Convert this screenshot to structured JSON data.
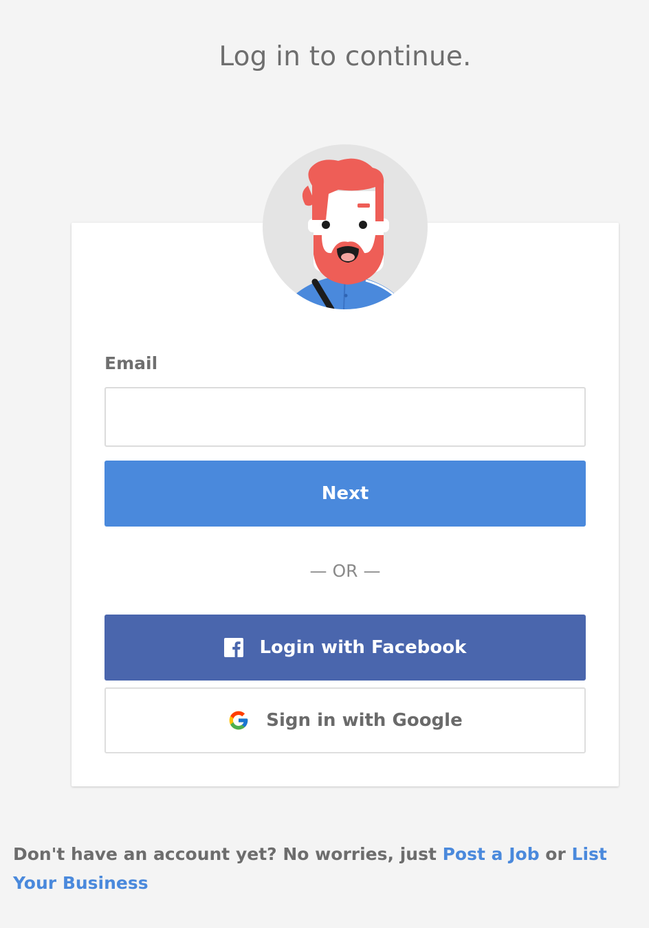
{
  "page": {
    "title": "Log in to continue."
  },
  "form": {
    "email_label": "Email",
    "email_value": "",
    "email_placeholder": "",
    "next_label": "Next",
    "divider_text": "— OR —",
    "facebook_label": "Login with Facebook",
    "google_label": "Sign in with Google"
  },
  "footer": {
    "prefix": "Don't have an account yet? No worries, just ",
    "post_job_link": "Post a Job",
    "joiner": " or ",
    "list_business_link": "List Your Business"
  },
  "colors": {
    "primary_blue": "#4a89dc",
    "facebook_blue": "#4a66ad",
    "background": "#f4f4f4",
    "avatar_hair": "#ee5e57"
  },
  "icons": {
    "avatar": "bearded-man-avatar",
    "facebook": "facebook-icon",
    "google": "google-icon"
  }
}
